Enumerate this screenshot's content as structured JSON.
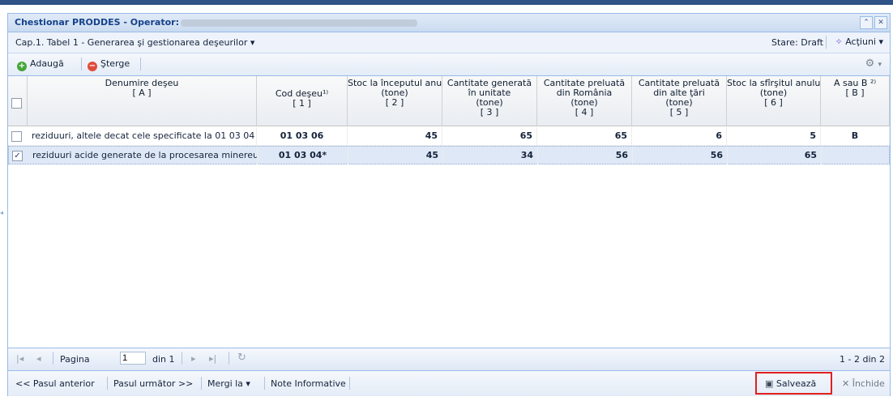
{
  "window": {
    "title": "Chestionar PRODDES - Operator:"
  },
  "section": {
    "menu_label": "Cap.1. Tabel 1 - Generarea şi gestionarea deşeurilor ▾",
    "status": "Stare: Draft",
    "actions_label": "Acţiuni ▾"
  },
  "toolbar": {
    "add_label": "Adaugă",
    "delete_label": "Şterge"
  },
  "table": {
    "columns": [
      {
        "lines": [
          "Denumire deşeu",
          "[ A ]"
        ]
      },
      {
        "lines": [
          "Cod deşeu¹⁾",
          "[ 1 ]"
        ]
      },
      {
        "lines": [
          "Stoc la începutul anului",
          "(tone)",
          "[ 2 ]"
        ]
      },
      {
        "lines": [
          "Cantitate generată",
          "în unitate",
          "(tone)",
          "[ 3 ]"
        ]
      },
      {
        "lines": [
          "Cantitate preluată",
          "din România",
          "(tone)",
          "[ 4 ]"
        ]
      },
      {
        "lines": [
          "Cantitate preluată",
          "din alte ţări",
          "(tone)",
          "[ 5 ]"
        ]
      },
      {
        "lines": [
          "Stoc la sfîrşitul anului",
          "(tone)",
          "[ 6 ]"
        ]
      },
      {
        "lines": [
          "A sau B ²⁾",
          "[ B ]"
        ]
      }
    ],
    "rows": [
      {
        "checked": false,
        "cells": [
          "reziduuri, altele decat cele specificate la 01 03 04",
          "01 03 06",
          "45",
          "65",
          "65",
          "6",
          "5",
          "B"
        ]
      },
      {
        "checked": true,
        "cells": [
          "reziduuri acide generate de la procesarea minereurilor",
          "01 03 04*",
          "45",
          "34",
          "56",
          "56",
          "65",
          ""
        ]
      }
    ]
  },
  "pager": {
    "page_label": "Pagina",
    "page_value": "1",
    "of_label": "din 1",
    "count_label": "1 - 2 din 2"
  },
  "footer": {
    "prev_label": "<< Pasul anterior",
    "next_label": "Pasul următor >>",
    "goto_label": "Mergi la ▾",
    "notes_label": "Note Informative",
    "save_label": "Salvează",
    "close_label": "Închide"
  },
  "colors": {
    "header_blue": "#15428b",
    "border_blue": "#99bbe8",
    "selected_row": "#dfe8f6",
    "highlight_red": "#e02020"
  }
}
